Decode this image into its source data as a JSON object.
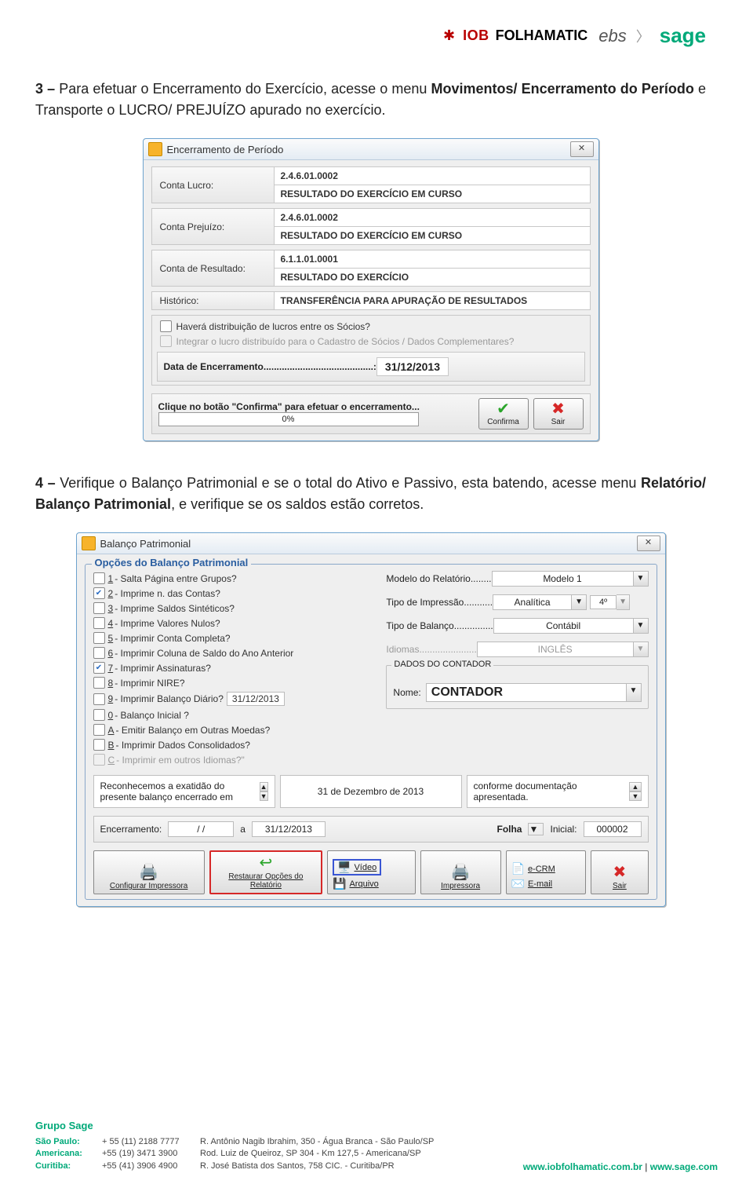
{
  "header_logos": {
    "iob": "IOB",
    "folhamatic": "FOLHAMATIC",
    "ebs": "ebs",
    "sage": "sage"
  },
  "para3": {
    "lead": "3 – ",
    "t1": "Para efetuar o Encerramento do Exercício, acesse o menu ",
    "b1": "Movimentos/ Encerramento do Período",
    "t2": " e Transporte o LUCRO/ PREJUÍZO apurado no exercício."
  },
  "dlg1": {
    "title": "Encerramento de Período",
    "close_x": "✕",
    "rows": {
      "lucro_label": "Conta Lucro:",
      "lucro_code": "2.4.6.01.0002",
      "lucro_desc": "RESULTADO DO EXERCÍCIO EM CURSO",
      "prej_label": "Conta Prejuízo:",
      "prej_code": "2.4.6.01.0002",
      "prej_desc": "RESULTADO DO EXERCÍCIO EM CURSO",
      "res_label": "Conta de Resultado:",
      "res_code": "6.1.1.01.0001",
      "res_desc": "RESULTADO DO EXERCÍCIO",
      "hist_label": "Histórico:",
      "hist_val": "TRANSFERÊNCIA PARA APURAÇÃO DE RESULTADOS"
    },
    "chk1": "Haverá distribuição de lucros entre os Sócios?",
    "chk2": "Integrar o lucro distribuído para o Cadastro de Sócios / Dados Complementares?",
    "date_label": "Data de Encerramento..........................................:",
    "date_val": "31/12/2013",
    "confirm_msg": "Clique no botão \"Confirma\" para efetuar o encerramento...",
    "progress": "0%",
    "btn_confirma": "Confirma",
    "btn_sair": "Sair"
  },
  "para4": {
    "lead": "4 – ",
    "t1": "Verifique o Balanço Patrimonial e se o total do Ativo e Passivo, esta batendo, acesse menu ",
    "b1": "Relatório/ Balanço Patrimonial",
    "t2": ", e verifique se os saldos estão corretos."
  },
  "dlg2": {
    "title": "Balanço Patrimonial",
    "close_x": "✕",
    "legend": "Opções do Balanço Patrimonial",
    "opts": {
      "o1": {
        "k": "1",
        "t": " - Salta Página entre Grupos?",
        "checked": false
      },
      "o2": {
        "k": "2",
        "t": " - Imprime n. das Contas?",
        "checked": true
      },
      "o3": {
        "k": "3",
        "t": " - Imprime Saldos Sintéticos?",
        "checked": false
      },
      "o4": {
        "k": "4",
        "t": " - Imprime Valores Nulos?",
        "checked": false
      },
      "o5": {
        "k": "5",
        "t": " - Imprimir Conta Completa?",
        "checked": false
      },
      "o6": {
        "k": "6",
        "t": " - Imprimir Coluna de Saldo do Ano Anterior",
        "checked": false
      },
      "o7": {
        "k": "7",
        "t": " - Imprimir Assinaturas?",
        "checked": true
      },
      "o8": {
        "k": "8",
        "t": " - Imprimir NIRE?",
        "checked": false
      },
      "o9": {
        "k": "9",
        "t": " - Imprimir Balanço Diário?",
        "checked": false,
        "date": "31/12/2013"
      },
      "o0": {
        "k": "0",
        "t": " - Balanço Inicial ?",
        "checked": false
      },
      "oA": {
        "k": "A",
        "t": " - Emitir Balanço em Outras Moedas?",
        "checked": false
      },
      "oB": {
        "k": "B",
        "t": " - Imprimir Dados Consolidados?",
        "checked": false
      },
      "oC": {
        "k": "C",
        "t": " - Imprimir em outros Idiomas?\"",
        "checked": false,
        "disabled": true
      }
    },
    "right": {
      "modelo_label": "Modelo do Relatório........",
      "modelo_val": "Modelo 1",
      "tipo_imp_label": "Tipo de Impressão...........",
      "tipo_imp_val": "Analítica",
      "tipo_imp_degree": "4º",
      "tipo_bal_label": "Tipo de Balanço...............",
      "tipo_bal_val": "Contábil",
      "idiomas_label": "Idiomas......................",
      "idiomas_val": "INGLÊS",
      "dados_contador": "DADOS DO CONTADOR",
      "nome_label": "Nome:",
      "nome_val": "CONTADOR"
    },
    "triple": {
      "left": "Reconhecemos a exatidão do presente balanço encerrado em",
      "mid": "31 de Dezembro de 2013",
      "right": "conforme documentação apresentada."
    },
    "enc": {
      "label": "Encerramento:",
      "d1": "/  /",
      "a": "a",
      "d2": "31/12/2013",
      "folha": "Folha",
      "inicial": "Inicial:",
      "inicial_val": "000002"
    },
    "btns": {
      "config": "Configurar Impressora",
      "restore": "Restaurar Opções do Relatório",
      "video": "Vídeo",
      "arquivo": "Arquivo",
      "impressora": "Impressora",
      "ecrm": "e-CRM",
      "email": "E-mail",
      "sair": "Sair"
    }
  },
  "footer": {
    "grupo": "Grupo Sage",
    "lines": [
      {
        "city": "São Paulo:",
        "phone": "+ 55 (11) 2188 7777",
        "addr": "R. Antônio Nagib Ibrahim, 350 - Água Branca - São Paulo/SP"
      },
      {
        "city": "Americana:",
        "phone": "+55 (19) 3471 3900",
        "addr": "Rod. Luiz de Queiroz, SP 304 - Km 127,5 - Americana/SP"
      },
      {
        "city": "Curitiba:",
        "phone": "+55 (41) 3906 4900",
        "addr": "R. José Batista dos Santos, 758 CIC. - Curitiba/PR"
      }
    ],
    "site1": "www.iobfolhamatic.com.br",
    "sep": "  |  ",
    "site2": "www.sage.com"
  }
}
